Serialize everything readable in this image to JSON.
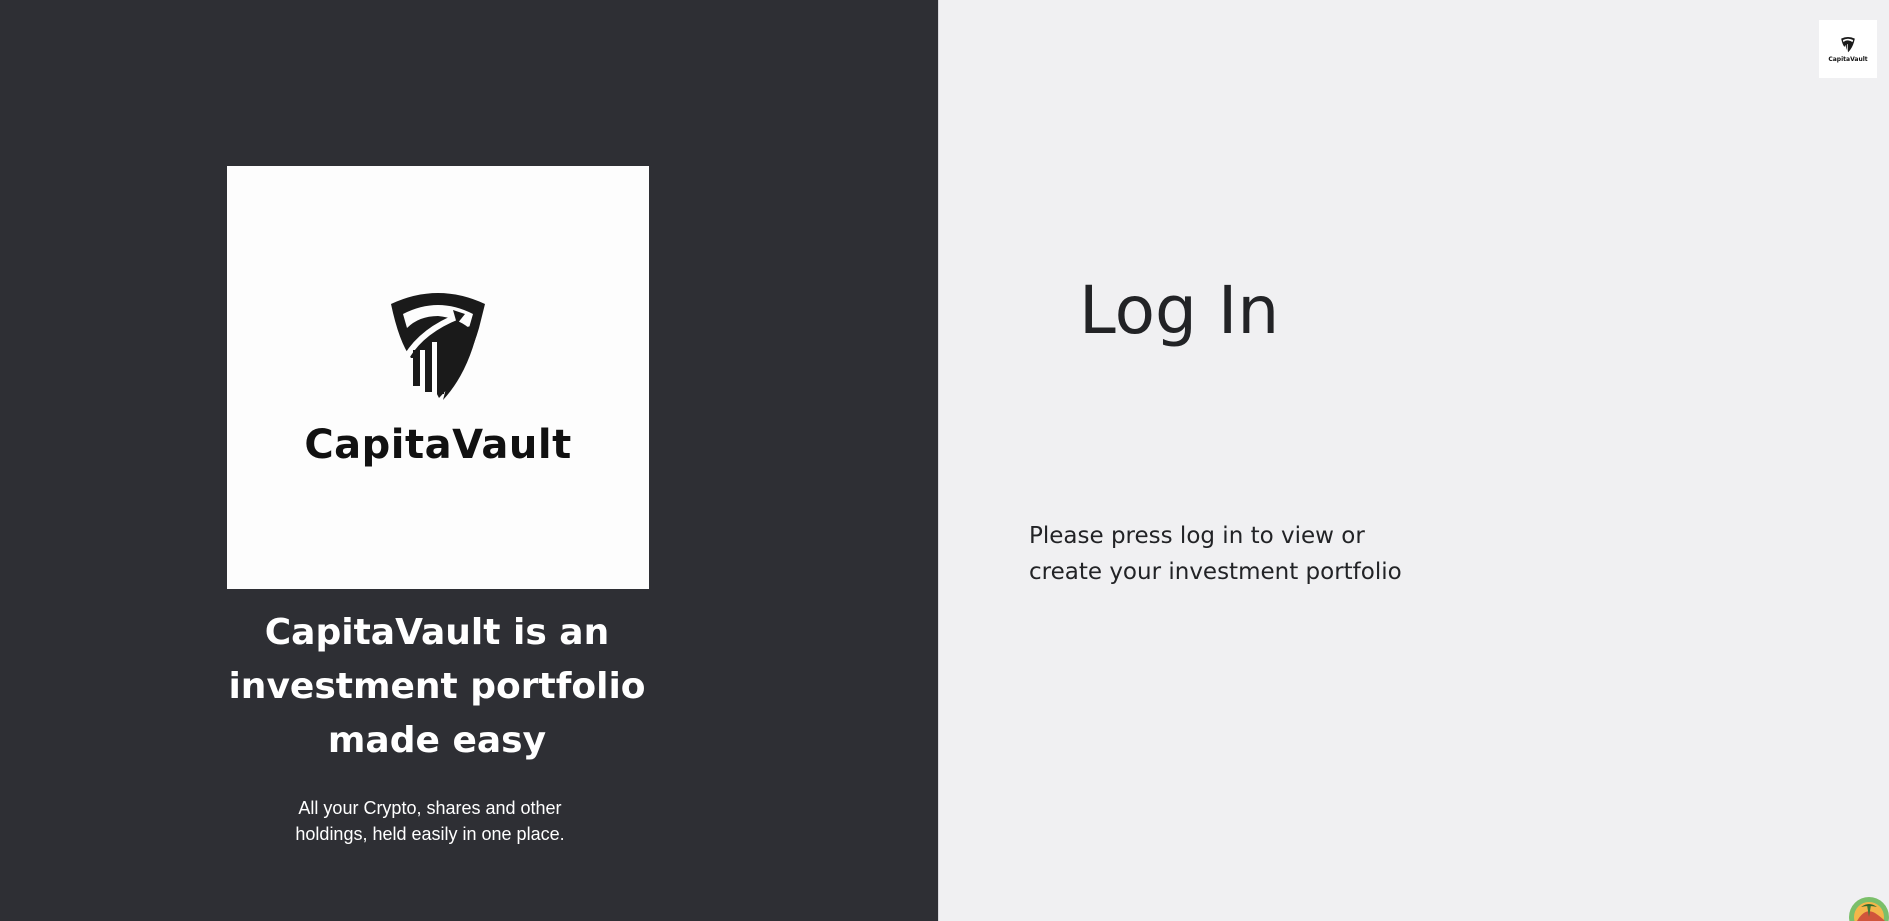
{
  "brand": {
    "name": "CapitaVault",
    "corner_logo_name": "CapitaVault"
  },
  "hero": {
    "tagline": "CapitaVault is an investment portfolio made easy",
    "subtext": "All your Crypto, shares and other holdings, held easily in one place."
  },
  "login": {
    "heading": "Log In",
    "message": "Please press log in to view or create your investment portfolio"
  },
  "colors": {
    "left_bg": "#2e2f34",
    "right_bg": "#f0f0f2",
    "text_dark": "#222326",
    "text_light": "#ffffff"
  },
  "icons": {
    "logo": "capitavault-shield-logo-icon",
    "badge": "floating-avatar-icon"
  }
}
